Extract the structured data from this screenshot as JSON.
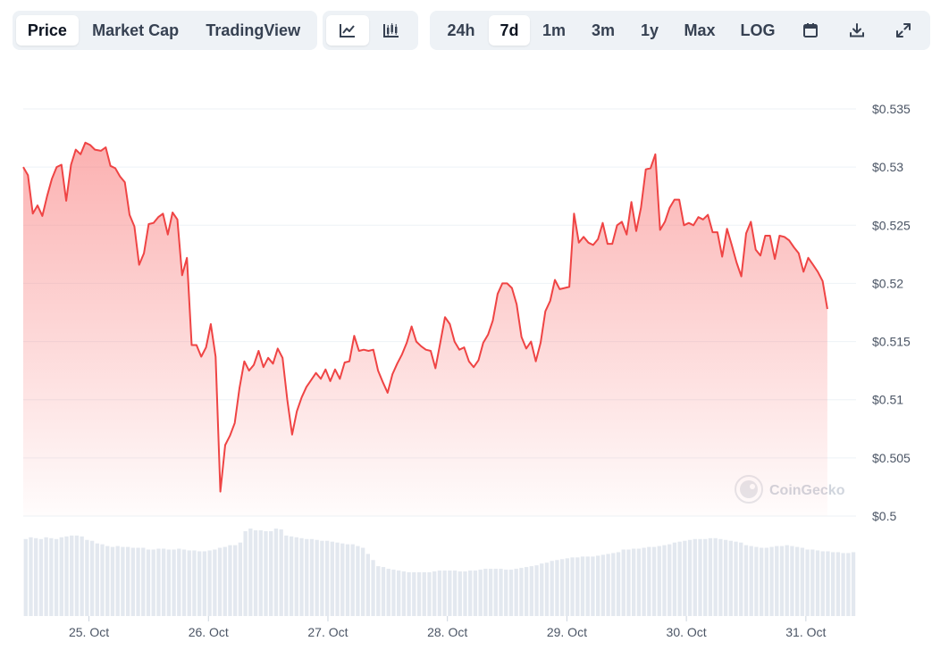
{
  "toolbar": {
    "view_tabs": [
      {
        "label": "Price",
        "active": true
      },
      {
        "label": "Market Cap",
        "active": false
      },
      {
        "label": "TradingView",
        "active": false
      }
    ],
    "chart_types": [
      {
        "icon": "line-chart-icon",
        "active": true
      },
      {
        "icon": "candlestick-chart-icon",
        "active": false
      }
    ],
    "ranges": [
      {
        "label": "24h",
        "active": false
      },
      {
        "label": "7d",
        "active": true
      },
      {
        "label": "1m",
        "active": false
      },
      {
        "label": "3m",
        "active": false
      },
      {
        "label": "1y",
        "active": false
      },
      {
        "label": "Max",
        "active": false
      },
      {
        "label": "LOG",
        "active": false
      }
    ],
    "actions": [
      {
        "icon": "calendar-icon"
      },
      {
        "icon": "download-icon"
      },
      {
        "icon": "expand-icon"
      }
    ]
  },
  "watermark": "CoinGecko",
  "colors": {
    "line": "#ef4444",
    "fill_top": "#f87171",
    "grid": "#eef2f6",
    "volume": "#e3e8ef",
    "text": "#4b5565"
  },
  "chart_data": {
    "type": "line",
    "title": "",
    "xlabel": "",
    "ylabel": "",
    "ylim": [
      0.5,
      0.535
    ],
    "yticks": [
      0.5,
      0.505,
      0.51,
      0.515,
      0.52,
      0.525,
      0.53,
      0.535
    ],
    "ytick_labels": [
      "$0.5",
      "$0.505",
      "$0.51",
      "$0.515",
      "$0.52",
      "$0.525",
      "$0.53",
      "$0.535"
    ],
    "xticks": [
      "25. Oct",
      "26. Oct",
      "27. Oct",
      "28. Oct",
      "29. Oct",
      "30. Oct",
      "31. Oct"
    ],
    "xrange_days": [
      24.45,
      31.42
    ],
    "grid": true,
    "legend": "none",
    "series": [
      {
        "values": [
          [
            24.45,
            0.53
          ],
          [
            24.49,
            0.5293
          ],
          [
            24.53,
            0.526
          ],
          [
            24.57,
            0.5267
          ],
          [
            24.61,
            0.5258
          ],
          [
            24.65,
            0.5275
          ],
          [
            24.69,
            0.529
          ],
          [
            24.73,
            0.53
          ],
          [
            24.77,
            0.5302
          ],
          [
            24.81,
            0.5271
          ],
          [
            24.85,
            0.5302
          ],
          [
            24.89,
            0.5315
          ],
          [
            24.93,
            0.5311
          ],
          [
            24.97,
            0.5321
          ],
          [
            25.01,
            0.5319
          ],
          [
            25.05,
            0.5315
          ],
          [
            25.1,
            0.5314
          ],
          [
            25.14,
            0.5317
          ],
          [
            25.18,
            0.5301
          ],
          [
            25.22,
            0.5299
          ],
          [
            25.26,
            0.5292
          ],
          [
            25.3,
            0.5287
          ],
          [
            25.34,
            0.5259
          ],
          [
            25.38,
            0.5249
          ],
          [
            25.42,
            0.5216
          ],
          [
            25.46,
            0.5226
          ],
          [
            25.5,
            0.5251
          ],
          [
            25.54,
            0.5252
          ],
          [
            25.58,
            0.5257
          ],
          [
            25.62,
            0.526
          ],
          [
            25.66,
            0.5242
          ],
          [
            25.7,
            0.5261
          ],
          [
            25.74,
            0.5255
          ],
          [
            25.78,
            0.5207
          ],
          [
            25.82,
            0.5222
          ],
          [
            25.86,
            0.5147
          ],
          [
            25.9,
            0.5147
          ],
          [
            25.94,
            0.5137
          ],
          [
            25.98,
            0.5145
          ],
          [
            26.02,
            0.5165
          ],
          [
            26.06,
            0.5137
          ],
          [
            26.1,
            0.5021
          ],
          [
            26.14,
            0.5061
          ],
          [
            26.18,
            0.5069
          ],
          [
            26.22,
            0.508
          ],
          [
            26.26,
            0.511
          ],
          [
            26.3,
            0.5133
          ],
          [
            26.34,
            0.5125
          ],
          [
            26.38,
            0.513
          ],
          [
            26.42,
            0.5142
          ],
          [
            26.46,
            0.5128
          ],
          [
            26.5,
            0.5136
          ],
          [
            26.54,
            0.5131
          ],
          [
            26.58,
            0.5144
          ],
          [
            26.62,
            0.5136
          ],
          [
            26.66,
            0.51
          ],
          [
            26.7,
            0.507
          ],
          [
            26.74,
            0.509
          ],
          [
            26.78,
            0.5102
          ],
          [
            26.82,
            0.5111
          ],
          [
            26.86,
            0.5117
          ],
          [
            26.9,
            0.5123
          ],
          [
            26.94,
            0.5118
          ],
          [
            26.98,
            0.5126
          ],
          [
            27.02,
            0.5116
          ],
          [
            27.06,
            0.5126
          ],
          [
            27.1,
            0.5118
          ],
          [
            27.14,
            0.5132
          ],
          [
            27.18,
            0.5133
          ],
          [
            27.22,
            0.5155
          ],
          [
            27.26,
            0.5142
          ],
          [
            27.3,
            0.5143
          ],
          [
            27.34,
            0.5142
          ],
          [
            27.38,
            0.5143
          ],
          [
            27.42,
            0.5125
          ],
          [
            27.46,
            0.5115
          ],
          [
            27.5,
            0.5106
          ],
          [
            27.54,
            0.5122
          ],
          [
            27.58,
            0.5131
          ],
          [
            27.62,
            0.5139
          ],
          [
            27.66,
            0.5149
          ],
          [
            27.7,
            0.5163
          ],
          [
            27.74,
            0.515
          ],
          [
            27.78,
            0.5146
          ],
          [
            27.82,
            0.5143
          ],
          [
            27.86,
            0.5142
          ],
          [
            27.9,
            0.5127
          ],
          [
            27.94,
            0.5149
          ],
          [
            27.98,
            0.5171
          ],
          [
            28.02,
            0.5165
          ],
          [
            28.06,
            0.515
          ],
          [
            28.1,
            0.5143
          ],
          [
            28.14,
            0.5145
          ],
          [
            28.18,
            0.5133
          ],
          [
            28.22,
            0.5128
          ],
          [
            28.26,
            0.5134
          ],
          [
            28.3,
            0.5149
          ],
          [
            28.34,
            0.5156
          ],
          [
            28.38,
            0.5168
          ],
          [
            28.42,
            0.5191
          ],
          [
            28.46,
            0.52
          ],
          [
            28.5,
            0.52
          ],
          [
            28.54,
            0.5196
          ],
          [
            28.58,
            0.5182
          ],
          [
            28.62,
            0.5154
          ],
          [
            28.66,
            0.5144
          ],
          [
            28.7,
            0.515
          ],
          [
            28.74,
            0.5133
          ],
          [
            28.78,
            0.5149
          ],
          [
            28.82,
            0.5176
          ],
          [
            28.86,
            0.5185
          ],
          [
            28.9,
            0.5203
          ],
          [
            28.94,
            0.5195
          ],
          [
            28.98,
            0.5196
          ],
          [
            29.02,
            0.5197
          ],
          [
            29.06,
            0.526
          ],
          [
            29.1,
            0.5235
          ],
          [
            29.14,
            0.524
          ],
          [
            29.18,
            0.5235
          ],
          [
            29.22,
            0.5233
          ],
          [
            29.26,
            0.5238
          ],
          [
            29.3,
            0.5252
          ],
          [
            29.34,
            0.5234
          ],
          [
            29.38,
            0.5234
          ],
          [
            29.42,
            0.525
          ],
          [
            29.46,
            0.5253
          ],
          [
            29.5,
            0.5242
          ],
          [
            29.54,
            0.527
          ],
          [
            29.58,
            0.5245
          ],
          [
            29.62,
            0.5265
          ],
          [
            29.66,
            0.5298
          ],
          [
            29.7,
            0.5299
          ],
          [
            29.74,
            0.5311
          ],
          [
            29.78,
            0.5246
          ],
          [
            29.82,
            0.5253
          ],
          [
            29.86,
            0.5265
          ],
          [
            29.9,
            0.5272
          ],
          [
            29.94,
            0.5272
          ],
          [
            29.98,
            0.525
          ],
          [
            30.02,
            0.5252
          ],
          [
            30.06,
            0.525
          ],
          [
            30.1,
            0.5257
          ],
          [
            30.14,
            0.5255
          ],
          [
            30.18,
            0.5259
          ],
          [
            30.22,
            0.5244
          ],
          [
            30.26,
            0.5244
          ],
          [
            30.3,
            0.5223
          ],
          [
            30.34,
            0.5247
          ],
          [
            30.38,
            0.5233
          ],
          [
            30.42,
            0.5218
          ],
          [
            30.46,
            0.5206
          ],
          [
            30.5,
            0.5243
          ],
          [
            30.54,
            0.5253
          ],
          [
            30.58,
            0.5229
          ],
          [
            30.62,
            0.5224
          ],
          [
            30.66,
            0.5241
          ],
          [
            30.7,
            0.5241
          ],
          [
            30.74,
            0.5221
          ],
          [
            30.78,
            0.5241
          ],
          [
            30.82,
            0.524
          ],
          [
            30.86,
            0.5237
          ],
          [
            30.9,
            0.5231
          ],
          [
            30.94,
            0.5226
          ],
          [
            30.98,
            0.521
          ],
          [
            31.02,
            0.5222
          ],
          [
            31.06,
            0.5216
          ],
          [
            31.1,
            0.521
          ],
          [
            31.14,
            0.5202
          ],
          [
            31.18,
            0.5178
          ]
        ]
      }
    ],
    "volume": [
      0.88,
      0.9,
      0.89,
      0.88,
      0.9,
      0.89,
      0.88,
      0.9,
      0.91,
      0.92,
      0.92,
      0.91,
      0.87,
      0.86,
      0.83,
      0.82,
      0.8,
      0.79,
      0.8,
      0.79,
      0.79,
      0.78,
      0.78,
      0.78,
      0.76,
      0.76,
      0.77,
      0.77,
      0.76,
      0.76,
      0.77,
      0.76,
      0.75,
      0.75,
      0.74,
      0.74,
      0.75,
      0.76,
      0.78,
      0.79,
      0.81,
      0.81,
      0.84,
      0.97,
      1.0,
      0.98,
      0.98,
      0.97,
      0.97,
      1.0,
      0.99,
      0.92,
      0.91,
      0.9,
      0.89,
      0.88,
      0.88,
      0.87,
      0.86,
      0.86,
      0.85,
      0.84,
      0.83,
      0.82,
      0.82,
      0.8,
      0.78,
      0.71,
      0.64,
      0.57,
      0.56,
      0.54,
      0.53,
      0.52,
      0.51,
      0.5,
      0.5,
      0.5,
      0.5,
      0.5,
      0.51,
      0.52,
      0.52,
      0.52,
      0.52,
      0.51,
      0.51,
      0.52,
      0.52,
      0.53,
      0.54,
      0.54,
      0.54,
      0.54,
      0.53,
      0.53,
      0.54,
      0.55,
      0.56,
      0.57,
      0.58,
      0.6,
      0.61,
      0.63,
      0.64,
      0.65,
      0.66,
      0.67,
      0.67,
      0.68,
      0.68,
      0.68,
      0.69,
      0.7,
      0.71,
      0.72,
      0.73,
      0.76,
      0.76,
      0.77,
      0.77,
      0.78,
      0.79,
      0.79,
      0.8,
      0.81,
      0.82,
      0.84,
      0.85,
      0.86,
      0.87,
      0.88,
      0.88,
      0.88,
      0.89,
      0.89,
      0.88,
      0.87,
      0.86,
      0.85,
      0.84,
      0.81,
      0.8,
      0.79,
      0.78,
      0.78,
      0.79,
      0.8,
      0.8,
      0.81,
      0.8,
      0.79,
      0.78,
      0.76,
      0.76,
      0.75,
      0.74,
      0.74,
      0.73,
      0.73,
      0.72,
      0.72,
      0.73
    ]
  }
}
